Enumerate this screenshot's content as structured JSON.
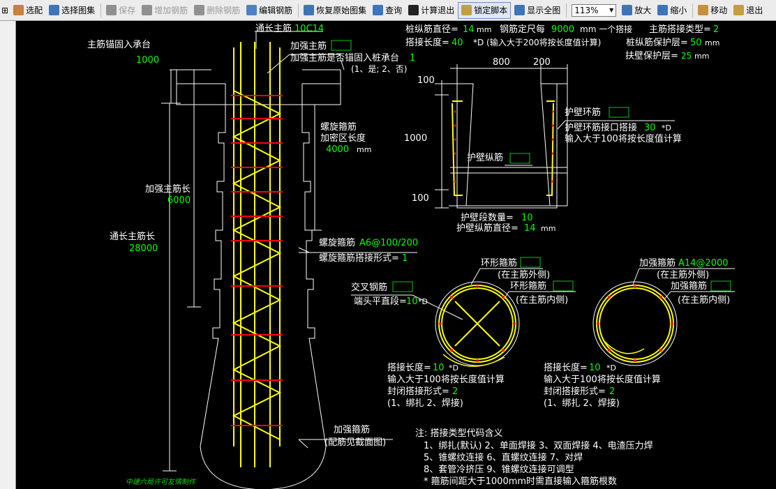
{
  "toolbar": {
    "first_glyph": "⊞",
    "items": [
      {
        "label": "选配",
        "icon": "select-icon",
        "color": "#c07020"
      },
      {
        "label": "选择图集",
        "icon": "atlas-icon",
        "color": "#2060b0"
      },
      {
        "label": "保存",
        "icon": "save-icon",
        "color": "#808080",
        "disabled": true
      },
      {
        "label": "增加钢筋",
        "icon": "add-rebar-icon",
        "color": "#808080",
        "disabled": true
      },
      {
        "label": "删除钢筋",
        "icon": "delete-rebar-icon",
        "color": "#808080",
        "disabled": true
      },
      {
        "label": "编辑钢筋",
        "icon": "edit-rebar-icon",
        "color": "#3070c0"
      },
      {
        "label": "恢复原始图集",
        "icon": "restore-icon",
        "color": "#2060b0"
      },
      {
        "label": "查询",
        "icon": "query-icon",
        "color": "#2060b0"
      },
      {
        "label": "计算退出",
        "icon": "fx-icon",
        "color": "#000000"
      },
      {
        "label": "锁定脚本",
        "icon": "lock-icon",
        "color": "#c09020",
        "active": true
      },
      {
        "label": "显示全图",
        "icon": "zoom-fit-icon",
        "color": "#2060b0"
      }
    ],
    "zoom_value": "113%",
    "right_items": [
      {
        "label": "放大",
        "icon": "zoom-in-icon",
        "color": "#2060b0"
      },
      {
        "label": "缩小",
        "icon": "zoom-out-icon",
        "color": "#2060b0"
      },
      {
        "label": "移动",
        "icon": "hand-icon",
        "color": "#c08020"
      },
      {
        "label": "退出",
        "icon": "exit-icon",
        "color": "#c09020"
      }
    ]
  },
  "drawing": {
    "colors": {
      "white": "#ffffff",
      "green": "#00ff00",
      "yellow": "#ffff00",
      "red": "#ff0000",
      "cyan": "#00ffff",
      "green_box": "#00cc00"
    },
    "left": {
      "anchor_label": "主筋锚固入承台",
      "anchor_value": "1000",
      "through_bar_label": "通长主筋",
      "through_bar_value": "10C14",
      "reinf_bar_label": "加强主筋",
      "reinf_anchor_label": "加强主筋是否锚固入桩承台",
      "reinf_anchor_value": "1",
      "reinf_anchor_options": "(1、是; 2、否)",
      "spiral_label_1": "螺旋箍筋",
      "spiral_label_2": "加密区长度",
      "spiral_dense_value": "4000",
      "unit_mm": "mm",
      "reinf_len_label": "加强主筋长",
      "reinf_len_value": "6000",
      "through_len_label": "通长主筋长",
      "through_len_value": "28000",
      "spiral_bar_label": "螺旋箍筋",
      "spiral_bar_value": "A6@100/200",
      "spiral_lap_label": "螺旋箍筋搭接形式=",
      "spiral_lap_value": "1",
      "reinf_stirrup_label": "加强箍筋",
      "reinf_stirrup_note": "(配筋见截面图)",
      "watermark": "中建六局许可友情制作"
    },
    "top_right": {
      "line1_label_a": "桩纵筋直径=",
      "line1_value_a": "14",
      "line1_unit_a": "mm",
      "line1_label_b": "钢筋定尺每",
      "line1_value_b": "9000",
      "line1_unit_b": "mm 一个搭接",
      "line1_label_c": "主筋搭接类型=",
      "line1_value_c": "2",
      "line2_label_a": "搭接长度=",
      "line2_value_a": "40",
      "line2_text_b": "*D (输入大于200将按长度值计算)",
      "line2_label_c": "桩纵筋保护层=",
      "line2_value_c": "50",
      "line2_unit_c": "mm",
      "line3_label": "扶壁保护层=",
      "line3_value": "25",
      "line3_unit": "mm"
    },
    "wall_section": {
      "dim_top_a": "800",
      "dim_top_b": "200",
      "dim_left_top": "100",
      "dim_left_mid": "1000",
      "dim_left_bot": "100",
      "ring_label": "护壁环筋",
      "ring_lap_label": "护壁环筋接口搭接",
      "ring_lap_value": "30",
      "ring_lap_unit": "*D",
      "ring_lap_note": "输入大于100将按长度值计算",
      "long_bar_label": "护壁纵筋",
      "segments_label": "护壁段数量=",
      "segments_value": "10",
      "long_dia_label": "护壁纵筋直径=",
      "long_dia_value": "14",
      "long_dia_unit": "mm"
    },
    "circle_left": {
      "ring_label": "环形箍筋",
      "ring_outside": "(在主筋外侧)",
      "ring_label_2": "环形箍筋",
      "ring_inside": "(在主筋内侧)",
      "cross_label": "交叉钢筋",
      "end_straight_label": "端头平直段=",
      "end_straight_value": "10",
      "end_straight_unit": "*D",
      "lap_label": "搭接长度=",
      "lap_value": "10",
      "lap_unit": "*D",
      "lap_note": "输入大于100将按长度值计算",
      "close_label": "封闭搭接形式=",
      "close_value": "2",
      "close_options": "(1、绑扎  2、焊接)"
    },
    "circle_right": {
      "stirrup_label": "加强箍筋",
      "stirrup_value": "A14@2000",
      "outside": "(在主筋外侧)",
      "stirrup_label_2": "加强箍筋",
      "inside": "(在主筋内侧)",
      "lap_label": "搭接长度=",
      "lap_value": "10",
      "lap_unit": "*D",
      "lap_note": "输入大于100将按长度值计算",
      "close_label": "封闭搭接形式=",
      "close_value": "2",
      "close_options": "(1、绑扎  2、焊接)"
    },
    "notes": {
      "title": "注: 搭接类型代码含义",
      "line1": "1、绑扎(默认)    2、单面焊接    3、双面焊接    4、电渣压力焊",
      "line2": "5、锥螺纹连接    6、直螺纹连接    7、对焊",
      "line3": "8、套管冷挤压    9、锥螺纹连接可调型",
      "line4": "* 箍筋间距大于1000mm时需直接输入箍筋根数"
    }
  }
}
